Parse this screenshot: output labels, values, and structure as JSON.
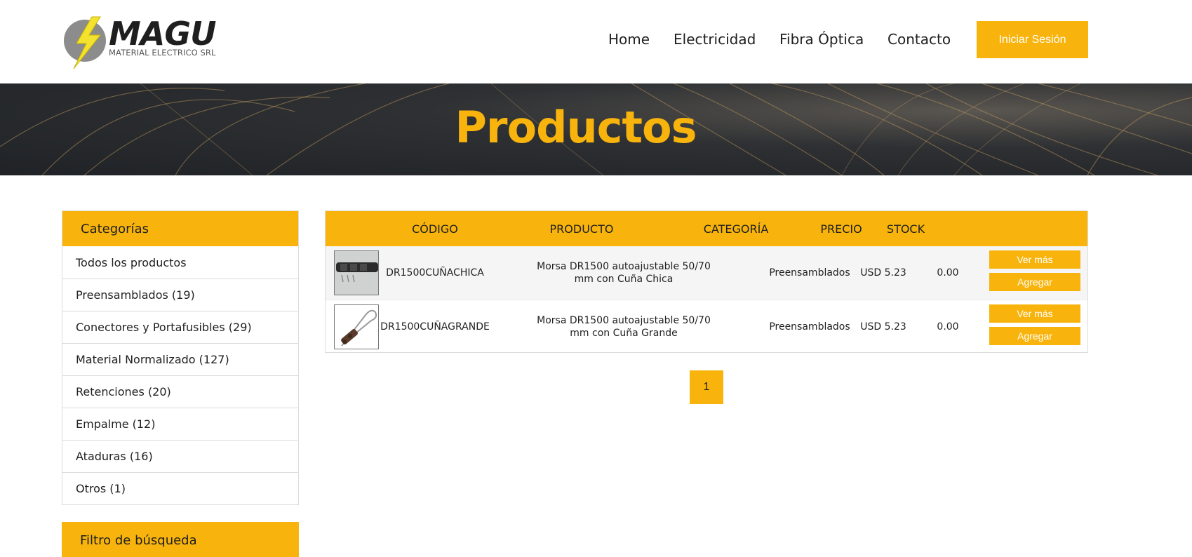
{
  "brand": {
    "name": "MAGU",
    "tagline": "MATERIAL ELECTRICO SRL"
  },
  "nav": {
    "items": [
      "Home",
      "Electricidad",
      "Fibra Óptica",
      "Contacto"
    ],
    "login_label": "Iniciar Sesión"
  },
  "hero": {
    "title": "Productos"
  },
  "sidebar": {
    "categories_title": "Categorías",
    "categories": [
      "Todos los productos",
      "Preensamblados (19)",
      "Conectores y Portafusibles (29)",
      "Material Normalizado (127)",
      "Retenciones (20)",
      "Empalme (12)",
      "Ataduras (16)",
      "Otros (1)"
    ],
    "filter_title": "Filtro de búsqueda"
  },
  "table": {
    "headers": [
      "CÓDIGO",
      "PRODUCTO",
      "CATEGORÍA",
      "PRECIO",
      "STOCK"
    ],
    "rows": [
      {
        "code": "DR1500CUÑACHICA",
        "product": "Morsa DR1500 autoajustable 50/70 mm con Cuña Chica",
        "category": "Preensamblados",
        "price": "USD 5.23",
        "stock": "0.00",
        "view_label": "Ver más",
        "add_label": "Agregar"
      },
      {
        "code": "DR1500CUÑAGRANDE",
        "product": "Morsa DR1500 autoajustable 50/70 mm con Cuña Grande",
        "category": "Preensamblados",
        "price": "USD 5.23",
        "stock": "0.00",
        "view_label": "Ver más",
        "add_label": "Agregar"
      }
    ]
  },
  "pagination": {
    "current": "1"
  },
  "colors": {
    "accent": "#f8b40c",
    "text": "#1f1f1f",
    "border": "#dcdcdc"
  }
}
